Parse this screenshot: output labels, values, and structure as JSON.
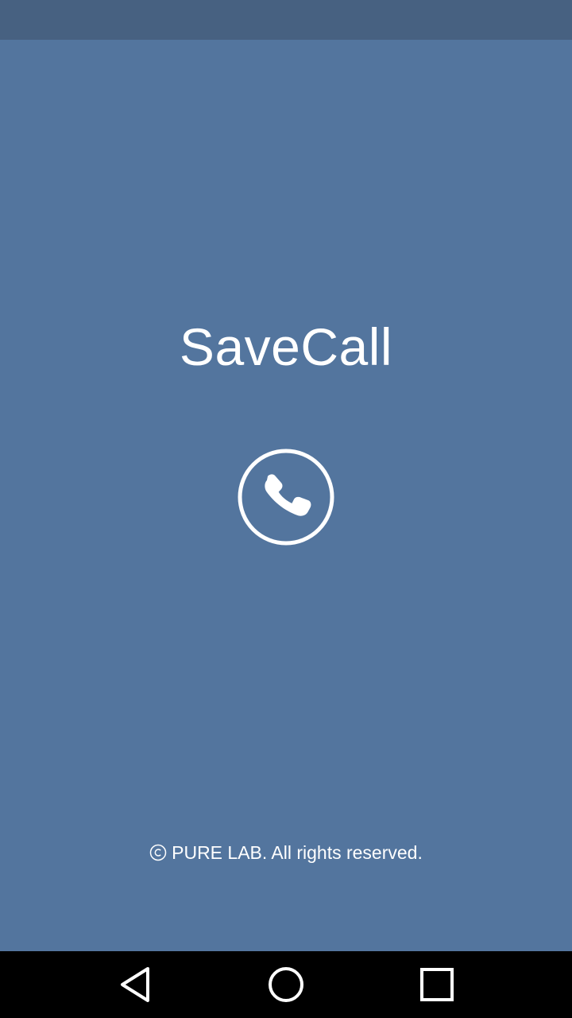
{
  "app": {
    "title": "SaveCall",
    "logo_icon": "phone-in-circle-icon",
    "copyright_text": "PURE LAB. All rights reserved.",
    "copyright_icon": "copyright-icon"
  },
  "colors": {
    "status_bar": "#476181",
    "background": "#53759E",
    "foreground": "#FFFFFF",
    "nav_bar": "#000000"
  },
  "nav_bar": {
    "back_icon": "back-triangle-icon",
    "home_icon": "home-circle-icon",
    "recents_icon": "recents-square-icon"
  }
}
